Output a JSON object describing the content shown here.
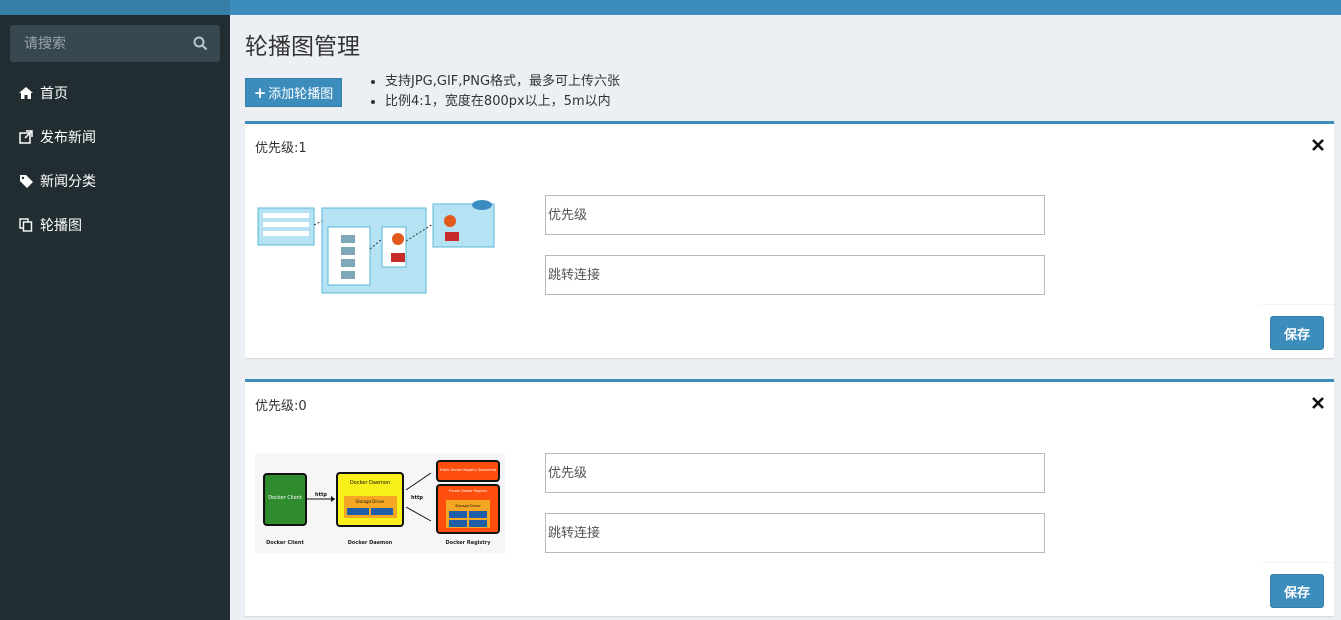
{
  "sidebar": {
    "search_placeholder": "请搜索",
    "items": [
      {
        "label": "首页",
        "icon": "home-icon"
      },
      {
        "label": "发布新闻",
        "icon": "external-link-icon"
      },
      {
        "label": "新闻分类",
        "icon": "tag-icon"
      },
      {
        "label": "轮播图",
        "icon": "copy-icon"
      }
    ]
  },
  "main": {
    "title": "轮播图管理",
    "add_button_label": "添加轮播图",
    "tips": [
      "支持JPG,GIF,PNG格式，最多可上传六张",
      "比例4:1，宽度在800px以上，5m以内"
    ],
    "slides": [
      {
        "priority_title": "优先级:1",
        "priority_placeholder": "优先级",
        "link_placeholder": "跳转连接",
        "save_label": "保存"
      },
      {
        "priority_title": "优先级:0",
        "priority_placeholder": "优先级",
        "link_placeholder": "跳转连接",
        "save_label": "保存"
      }
    ],
    "diagram2": {
      "client": "Docker Client",
      "daemon": "Docker Daemon",
      "registry": "Docker Registry",
      "http": "http",
      "storage_driver": "Storage Driver",
      "public_registry": "Public Docker Registry DockerHub",
      "private_registry": "Private Docker Registry"
    }
  },
  "colors": {
    "accent": "#3c8dbc",
    "sidebar_bg": "#222d32",
    "content_bg": "#ecf0f5"
  }
}
